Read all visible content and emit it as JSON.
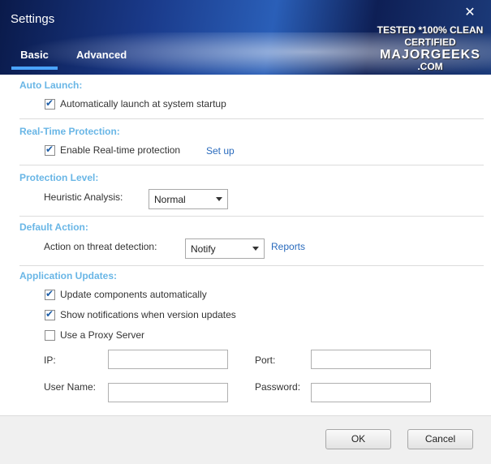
{
  "window": {
    "title": "Settings",
    "close_glyph": "✕"
  },
  "tabs": [
    {
      "label": "Basic",
      "active": true
    },
    {
      "label": "Advanced",
      "active": false
    }
  ],
  "watermark": {
    "line1": "TESTED *100% CLEAN",
    "line2": "CERTIFIED",
    "line3": "MAJORGEEKS",
    "line4": ".COM"
  },
  "sections": {
    "auto_launch": {
      "title": "Auto Launch:",
      "checkbox_label": "Automatically launch at system startup",
      "checked": true
    },
    "realtime": {
      "title": "Real-Time Protection:",
      "checkbox_label": "Enable Real-time protection",
      "checked": true,
      "link": "Set up"
    },
    "protection_level": {
      "title": "Protection Level:",
      "field_label": "Heuristic Analysis:",
      "selected": "Normal"
    },
    "default_action": {
      "title": "Default Action:",
      "field_label": "Action on threat detection:",
      "selected": "Notify",
      "link": "Reports"
    },
    "app_updates": {
      "title": "Application Updates:",
      "update_label": "Update components automatically",
      "update_checked": true,
      "notify_label": "Show notifications when version updates",
      "notify_checked": true,
      "proxy_label": "Use a Proxy Server",
      "proxy_checked": false,
      "ip_label": "IP:",
      "ip_value": "",
      "port_label": "Port:",
      "port_value": "",
      "username_label": "User Name:",
      "username_value": "",
      "password_label": "Password:",
      "password_value": ""
    }
  },
  "footer": {
    "ok": "OK",
    "cancel": "Cancel"
  },
  "colors": {
    "section_title": "#69b6e6",
    "link": "#2a6bbd",
    "tab_indicator": "#4aa3ff"
  }
}
